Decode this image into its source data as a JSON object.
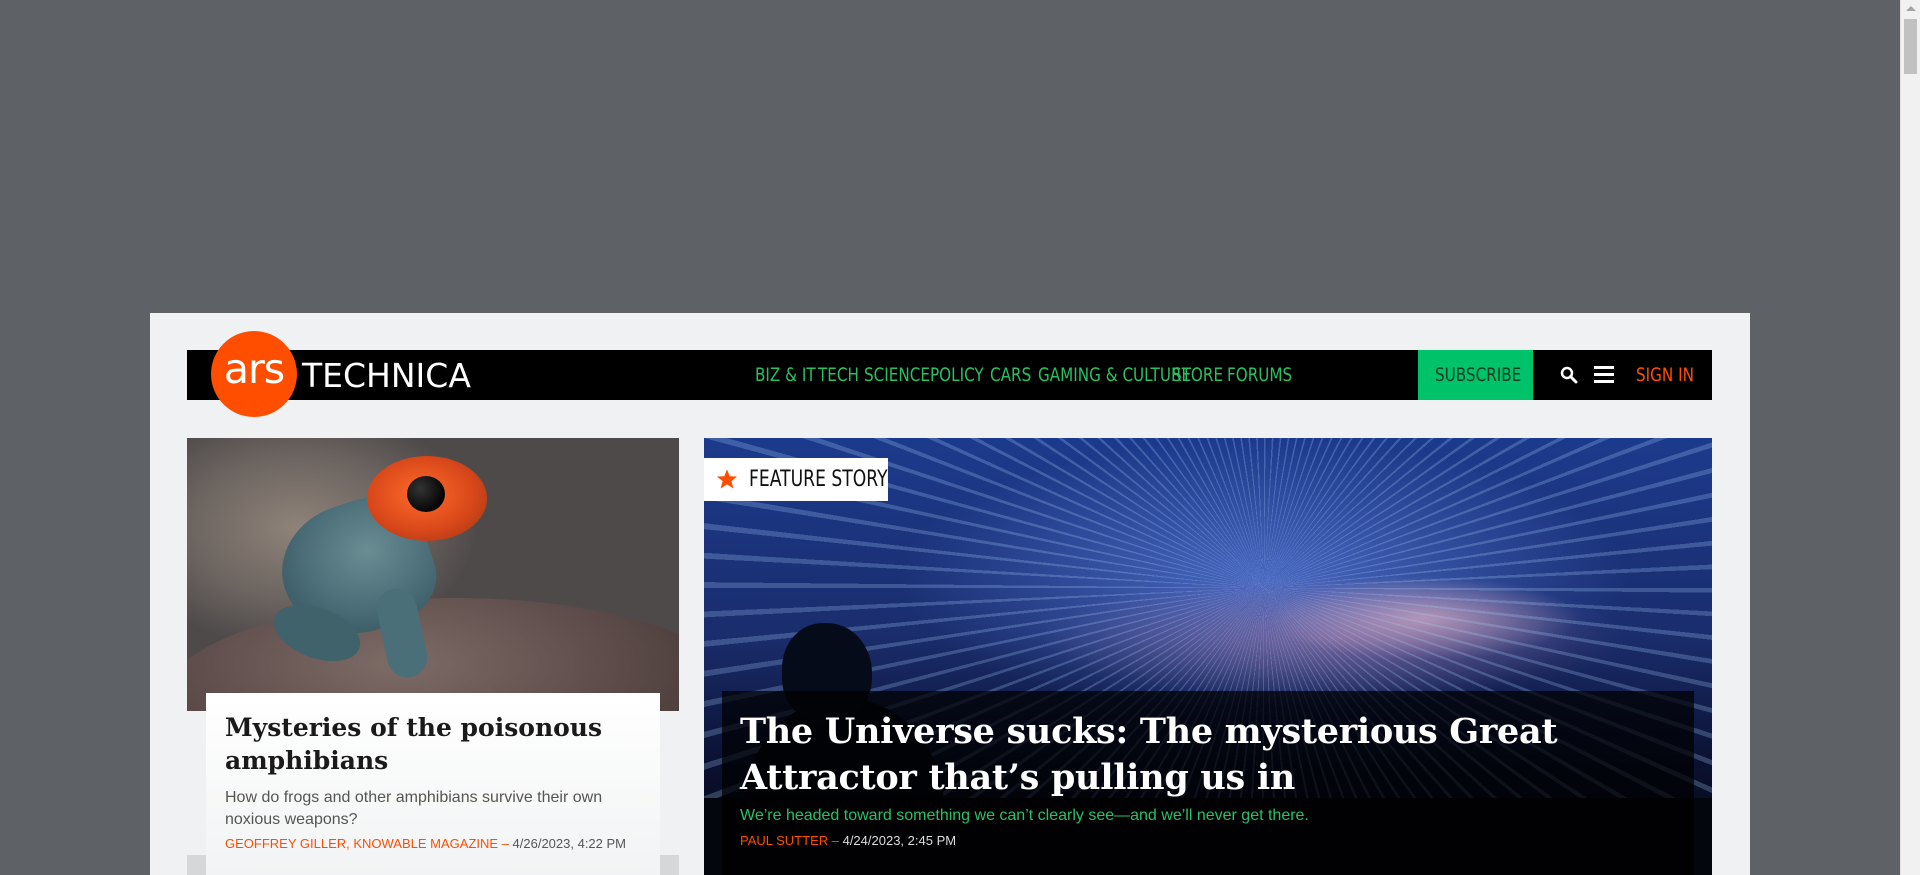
{
  "brand": {
    "logo_ars": "ars",
    "logo_technica": "TECHNICA",
    "accent": "#ff4e00",
    "nav_green": "#27c162"
  },
  "nav": {
    "items": [
      "BIZ & IT",
      "TECH",
      "SCIENCE",
      "POLICY",
      "CARS",
      "GAMING & CULTURE",
      "STORE",
      "FORUMS"
    ],
    "subscribe": "SUBSCRIBE",
    "sign_in": "SIGN IN",
    "icons": [
      "search-icon",
      "hamburger-menu-icon"
    ]
  },
  "left_story": {
    "title": "Mysteries of the poisonous amphibians",
    "description": "How do frogs and other amphibians survive their own noxious weapons?",
    "author": "GEOFFREY GILLER, KNOWABLE MAGAZINE",
    "separator": " – ",
    "timestamp": "4/26/2023, 4:22 PM"
  },
  "feature_story": {
    "badge": "FEATURE STORY",
    "title": "The Universe sucks: The mysterious Great Attractor that’s pulling us in",
    "description": "We’re headed toward something we can’t clearly see—and we’ll never get there.",
    "author": "PAUL SUTTER",
    "separator": " – ",
    "timestamp": "4/24/2023, 2:45 PM"
  }
}
